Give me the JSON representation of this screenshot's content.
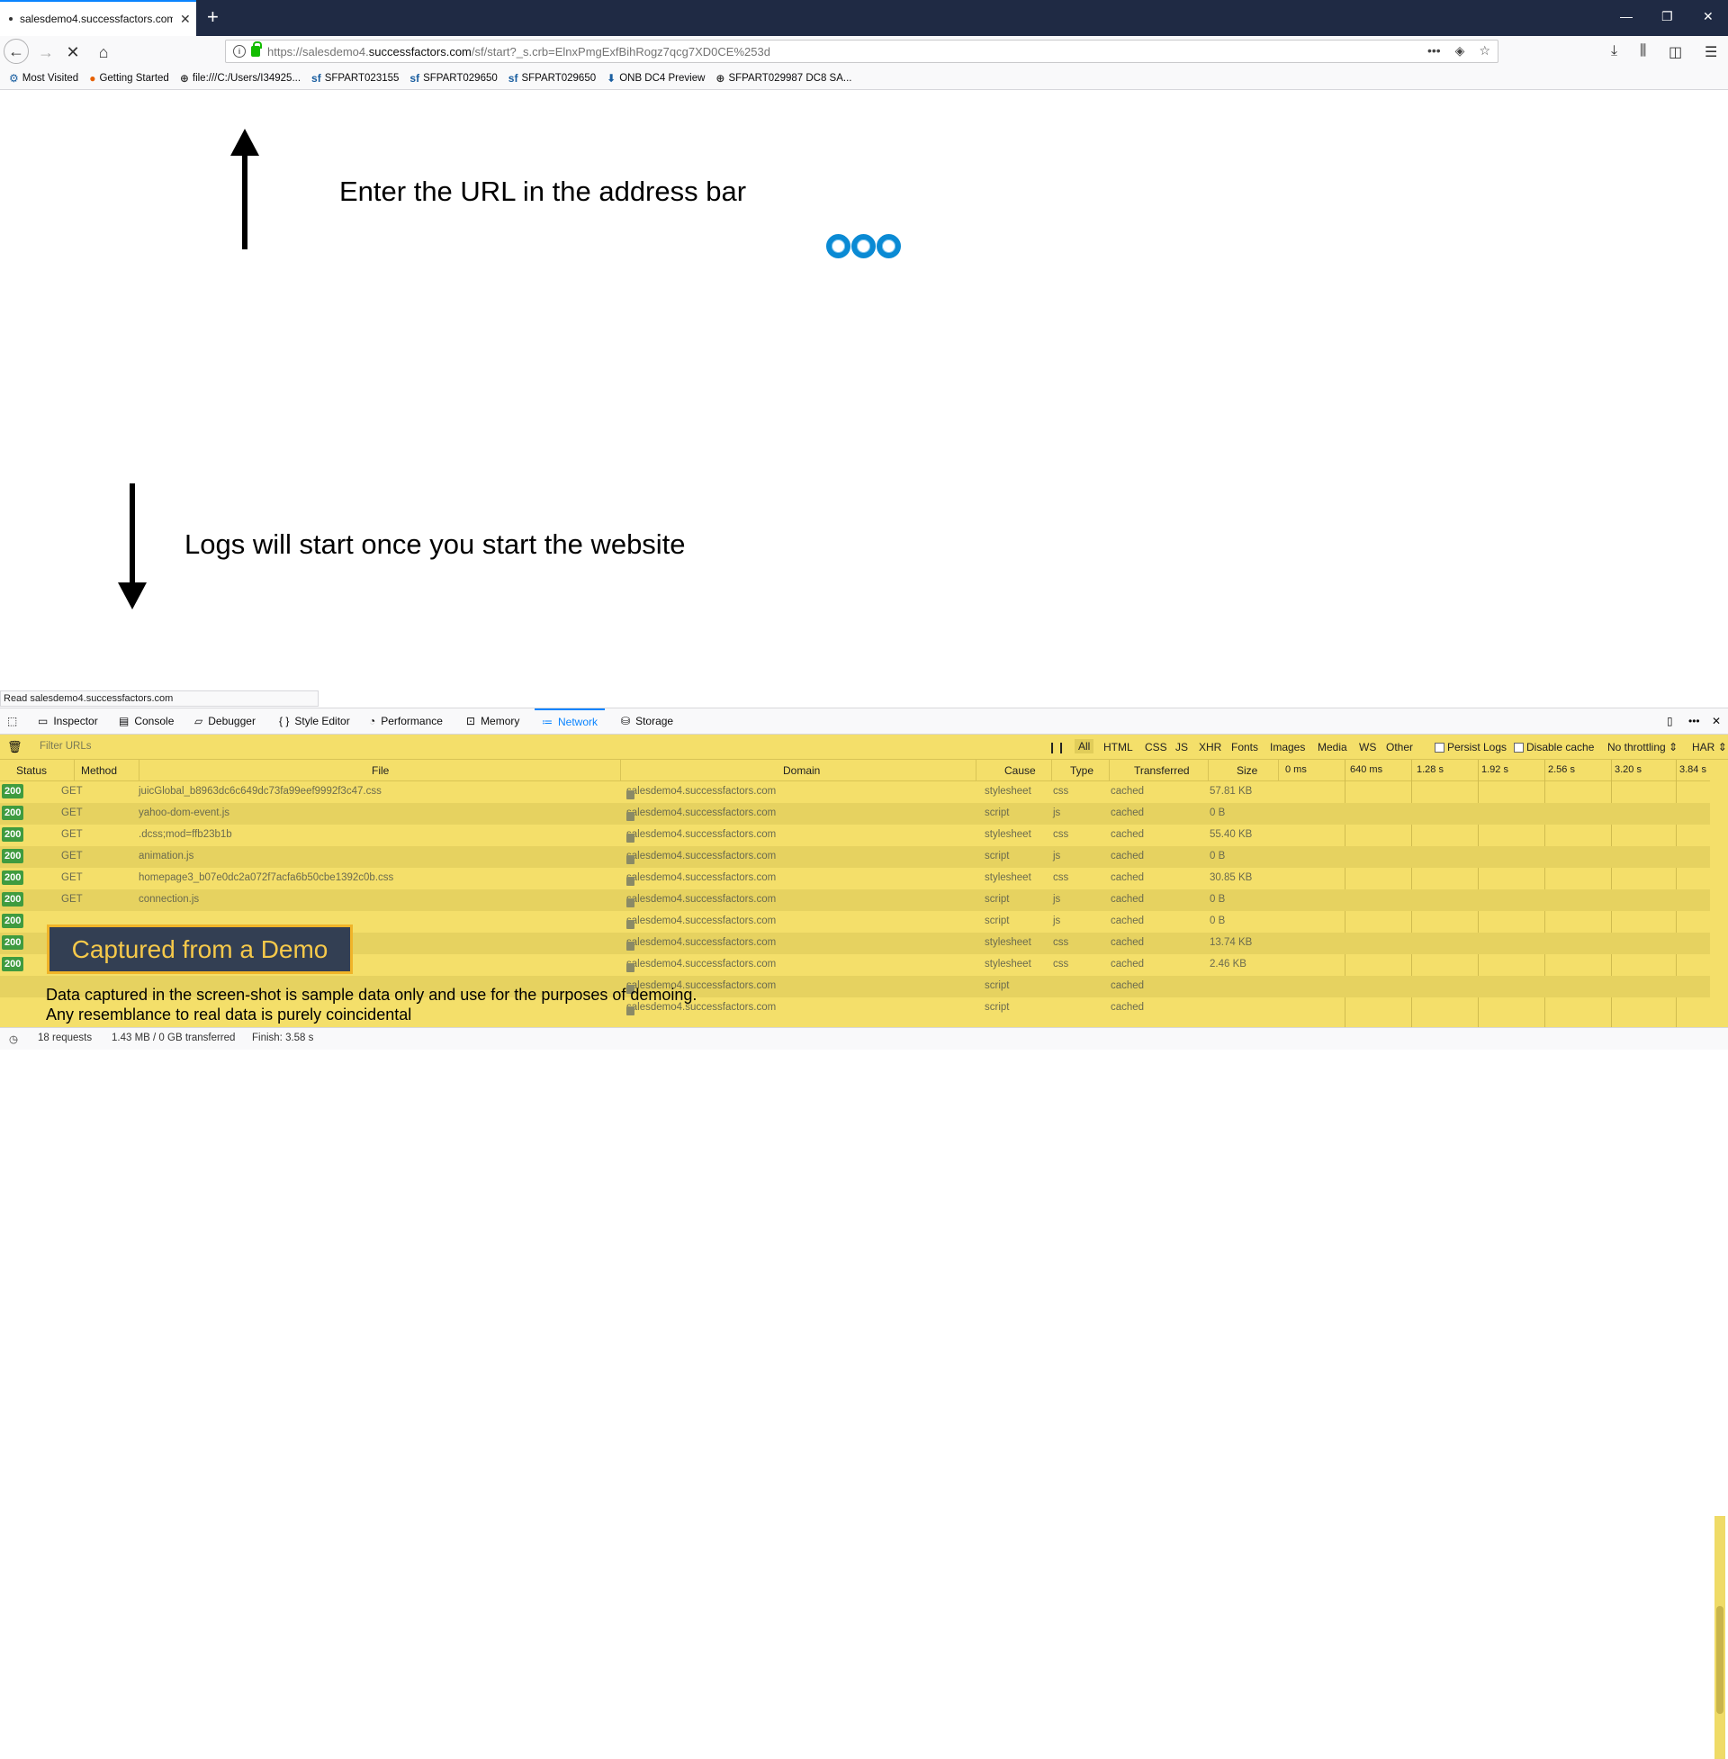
{
  "browser": {
    "tab_title": "salesdemo4.successfactors.com",
    "url_prefix": "https://salesdemo4.",
    "url_domain": "successfactors.com",
    "url_path": "/sf/start?_s.crb=ElnxPmgExfBihRogz7qcg7XD0CE%253d"
  },
  "bookmarks": [
    {
      "label": "Most Visited",
      "icon": "gear-icon"
    },
    {
      "label": "Getting Started",
      "icon": "firefox-icon"
    },
    {
      "label": "file:///C:/Users/I34925...",
      "icon": "globe-icon"
    },
    {
      "label": "SFPART023155",
      "icon": "sf-icon"
    },
    {
      "label": "SFPART029650",
      "icon": "sf-icon"
    },
    {
      "label": "SFPART029650",
      "icon": "sf-icon"
    },
    {
      "label": "ONB DC4 Preview",
      "icon": "download-icon"
    },
    {
      "label": "SFPART029987 DC8 SA...",
      "icon": "globe-icon"
    }
  ],
  "annotations": {
    "top": "Enter the URL in the address bar",
    "bottom": "Logs will start once you start the website"
  },
  "status_link": "Read salesdemo4.successfactors.com",
  "devtools": {
    "tabs": [
      "Inspector",
      "Console",
      "Debugger",
      "Style Editor",
      "Performance",
      "Memory",
      "Network",
      "Storage"
    ],
    "active_tab": "Network",
    "filter_placeholder": "Filter URLs",
    "type_filters": [
      "All",
      "HTML",
      "CSS",
      "JS",
      "XHR",
      "Fonts",
      "Images",
      "Media",
      "WS",
      "Other"
    ],
    "persist_logs": "Persist Logs",
    "disable_cache": "Disable cache",
    "throttling": "No throttling",
    "har": "HAR"
  },
  "columns": [
    "Status",
    "Method",
    "File",
    "Domain",
    "Cause",
    "Type",
    "Transferred",
    "Size"
  ],
  "timeline": [
    "0 ms",
    "640 ms",
    "1.28 s",
    "1.92 s",
    "2.56 s",
    "3.20 s",
    "3.84 s"
  ],
  "requests": [
    {
      "status": "200",
      "method": "GET",
      "file": "juicGlobal_b8963dc6c649dc73fa99eef9992f3c47.css",
      "domain": "salesdemo4.successfactors.com",
      "cause": "stylesheet",
      "type": "css",
      "transferred": "cached",
      "size": "57.81 KB"
    },
    {
      "status": "200",
      "method": "GET",
      "file": "yahoo-dom-event.js",
      "domain": "salesdemo4.successfactors.com",
      "cause": "script",
      "type": "js",
      "transferred": "cached",
      "size": "0 B"
    },
    {
      "status": "200",
      "method": "GET",
      "file": ".dcss;mod=ffb23b1b",
      "domain": "salesdemo4.successfactors.com",
      "cause": "stylesheet",
      "type": "css",
      "transferred": "cached",
      "size": "55.40 KB"
    },
    {
      "status": "200",
      "method": "GET",
      "file": "animation.js",
      "domain": "salesdemo4.successfactors.com",
      "cause": "script",
      "type": "js",
      "transferred": "cached",
      "size": "0 B"
    },
    {
      "status": "200",
      "method": "GET",
      "file": "homepage3_b07e0dc2a072f7acfa6b50cbe1392c0b.css",
      "domain": "salesdemo4.successfactors.com",
      "cause": "stylesheet",
      "type": "css",
      "transferred": "cached",
      "size": "30.85 KB"
    },
    {
      "status": "200",
      "method": "GET",
      "file": "connection.js",
      "domain": "salesdemo4.successfactors.com",
      "cause": "script",
      "type": "js",
      "transferred": "cached",
      "size": "0 B"
    },
    {
      "status": "200",
      "method": "",
      "file": "",
      "domain": "salesdemo4.successfactors.com",
      "cause": "script",
      "type": "js",
      "transferred": "cached",
      "size": "0 B"
    },
    {
      "status": "200",
      "method": "",
      "file": "",
      "domain": "salesdemo4.successfactors.com",
      "cause": "stylesheet",
      "type": "css",
      "transferred": "cached",
      "size": "13.74 KB"
    },
    {
      "status": "200",
      "method": "",
      "file": "",
      "domain": "salesdemo4.successfactors.com",
      "cause": "stylesheet",
      "type": "css",
      "transferred": "cached",
      "size": "2.46 KB"
    },
    {
      "status": "",
      "method": "",
      "file": "",
      "domain": "salesdemo4.successfactors.com",
      "cause": "script",
      "type": "",
      "transferred": "cached",
      "size": ""
    },
    {
      "status": "",
      "method": "",
      "file": "",
      "domain": "salesdemo4.successfactors.com",
      "cause": "script",
      "type": "",
      "transferred": "cached",
      "size": ""
    }
  ],
  "overlay": {
    "demo_label": "Captured from a Demo",
    "disclaimer_line1": "Data captured in the screen-shot is sample data only and use for the purposes of demoing.",
    "disclaimer_line2": "Any resemblance to real data is purely coincidental"
  },
  "statusbar": {
    "requests": "18 requests",
    "transferred": "1.43 MB / 0 GB transferred",
    "finish": "Finish: 3.58 s"
  },
  "colors": {
    "accent": "#0a84ff",
    "panel": "#f4df6a",
    "status_ok": "#3f9b3f",
    "demo_bg": "#333f53",
    "demo_text": "#f6c94a"
  }
}
